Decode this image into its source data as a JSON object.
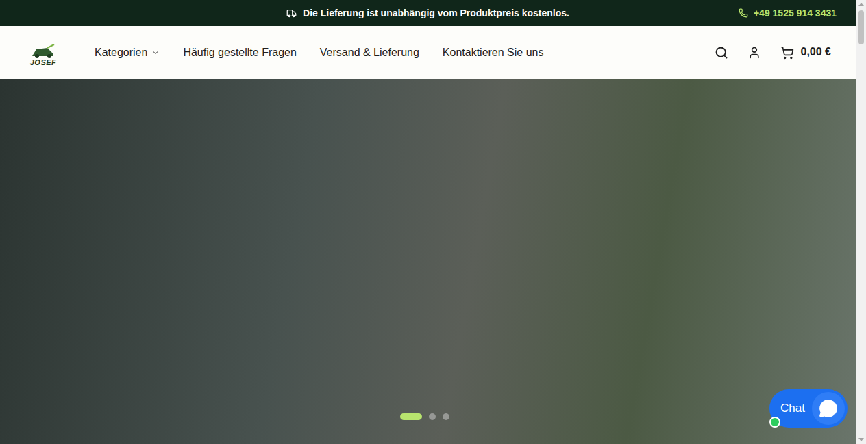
{
  "announcement": {
    "text": "Die Lieferung ist unabhängig vom Produktpreis kostenlos.",
    "phone": "+49 1525 914 3431"
  },
  "logo": {
    "text": "JOSEF"
  },
  "nav": [
    {
      "label": "Kategorien",
      "has_dropdown": true
    },
    {
      "label": "Häufig gestellte Fragen",
      "has_dropdown": false
    },
    {
      "label": "Versand & Lieferung",
      "has_dropdown": false
    },
    {
      "label": "Kontaktieren Sie uns",
      "has_dropdown": false
    }
  ],
  "cart": {
    "total": "0,00 €"
  },
  "hero": {
    "slides": [
      {
        "selected": true
      },
      {
        "selected": false
      },
      {
        "selected": false
      }
    ]
  },
  "chat": {
    "label": "Chat",
    "online": true
  }
}
